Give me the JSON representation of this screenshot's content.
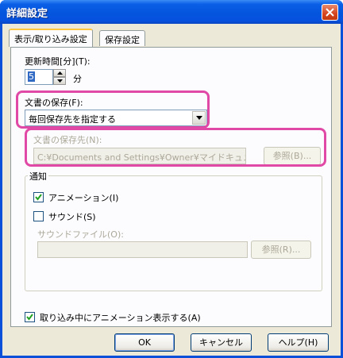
{
  "window": {
    "title": "詳細設定",
    "close": "×"
  },
  "tabs": [
    "表示/取り込み設定",
    "保存設定"
  ],
  "refresh": {
    "label": "更新時間[分](T):",
    "value": "5",
    "unit": "分"
  },
  "save": {
    "label": "文書の保存(F):",
    "selected": "毎回保存先を指定する"
  },
  "saveto": {
    "label": "文書の保存先(N):",
    "path": "C:¥Documents and Settings¥Owner¥マイドキュメント¥スクラップ",
    "browse": "参照(B)..."
  },
  "notify": {
    "title": "通知",
    "animation": {
      "label": "アニメーション(I)",
      "checked": true
    },
    "sound": {
      "label": "サウンド(S)",
      "checked": false
    },
    "soundfile": {
      "label": "サウンドファイル(O):",
      "value": "",
      "browse": "参照(R)..."
    }
  },
  "import_anim": {
    "label": "取り込み中にアニメーション表示する(A)",
    "checked": true
  },
  "buttons": {
    "ok": "OK",
    "cancel": "キャンセル",
    "help": "ヘルプ(H)"
  },
  "colors": {
    "highlight": "#e04aa6",
    "titlebar": "#0454dd"
  }
}
